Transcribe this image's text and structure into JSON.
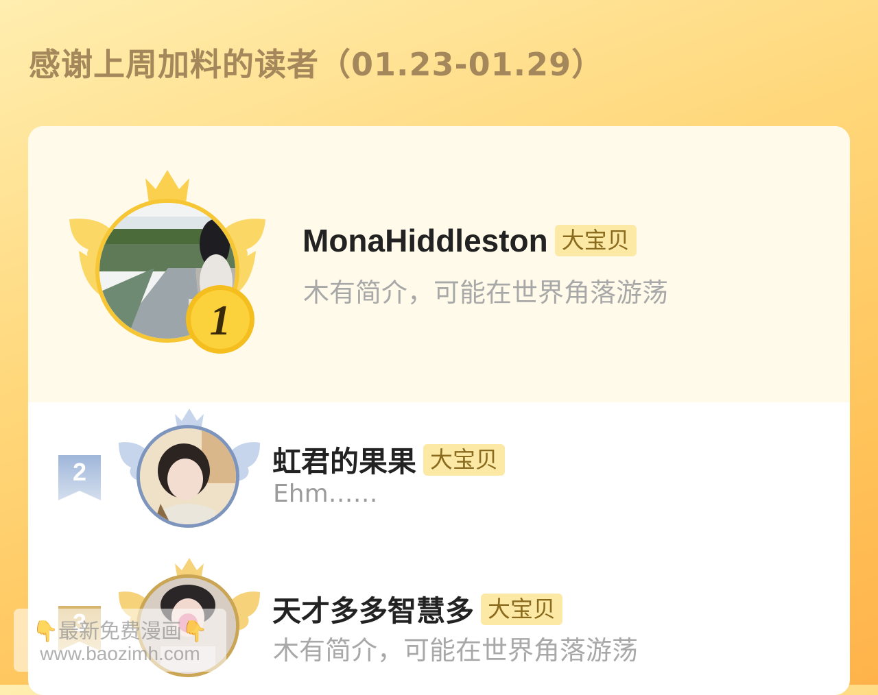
{
  "header": {
    "title": "感谢上周加料的读者（01.23-01.29）"
  },
  "readers": [
    {
      "rank": "1",
      "name": "MonaHiddleston",
      "badge": "大宝贝",
      "bio": "木有简介，可能在世界角落游荡"
    },
    {
      "rank": "2",
      "name": "虹君的果果",
      "badge": "大宝贝",
      "bio": "Ehm……"
    },
    {
      "rank": "3",
      "name": "天才多多智慧多",
      "badge": "大宝贝",
      "bio": "木有简介，可能在世界角落游荡"
    }
  ],
  "watermark": {
    "line1": "👇最新免费漫画👇",
    "line2": "www.baozimh.com"
  },
  "colors": {
    "gold": "#f6c634",
    "silver": "#7d95bd",
    "bronze": "#c9a554",
    "badge_bg": "#fde9a6",
    "badge_text": "#8a6b1e",
    "title": "#a4875a"
  }
}
